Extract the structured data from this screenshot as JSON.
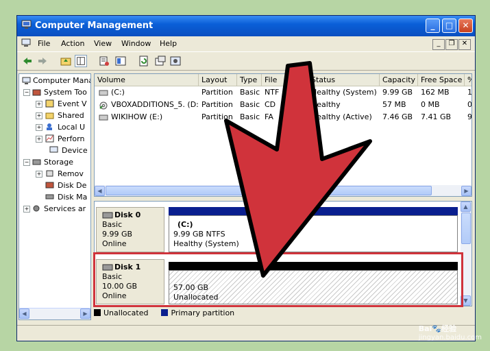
{
  "window": {
    "title": "Computer Management",
    "icon": "computer-management-icon"
  },
  "menu": [
    "File",
    "Action",
    "View",
    "Window",
    "Help"
  ],
  "tree": {
    "root": "Computer Mana",
    "system_tools": "System Too",
    "event_viewer": "Event V",
    "shared": "Shared",
    "local_users": "Local U",
    "performance": "Perforn",
    "device": "Device",
    "storage": "Storage",
    "removable": "Remov",
    "disk_defrag": "Disk De",
    "disk_mgmt": "Disk Ma",
    "services": "Services ar"
  },
  "volumes": {
    "columns": [
      "Volume",
      "Layout",
      "Type",
      "File",
      "Status",
      "Capacity",
      "Free Space",
      "%"
    ],
    "rows": [
      [
        "(C:)",
        "Partition",
        "Basic",
        "NTF",
        "Healthy (System)",
        "9.99 GB",
        "162 MB",
        "1"
      ],
      [
        "VBOXADDITIONS_5. (D:)",
        "Partition",
        "Basic",
        "CD",
        "Healthy",
        "57 MB",
        "0 MB",
        "0"
      ],
      [
        "WIKIHOW (E:)",
        "Partition",
        "Basic",
        "FA",
        "Healthy (Active)",
        "7.46 GB",
        "7.41 GB",
        "9"
      ]
    ]
  },
  "disks": [
    {
      "name": "Disk 0",
      "type": "Basic",
      "size": "9.99 GB",
      "status": "Online",
      "partition": {
        "label": "(C:)",
        "detail": "9.99 GB NTFS",
        "state": "Healthy (System)"
      }
    },
    {
      "name": "Disk 1",
      "type": "Basic",
      "size": "10.00 GB",
      "status": "Online",
      "partition": {
        "detail": "57.00 GB",
        "state": "Unallocated"
      }
    }
  ],
  "legend": {
    "unallocated": "Unallocated",
    "primary": "Primary partition"
  },
  "watermark": {
    "brand": "Bai",
    "brand2": "经验",
    "url": "jingyan.baidu.com"
  },
  "colors": {
    "annotation_red": "#d0333b",
    "primary_partition": "#0a1f8f",
    "titlebar_blue": "#0b5fd8"
  }
}
